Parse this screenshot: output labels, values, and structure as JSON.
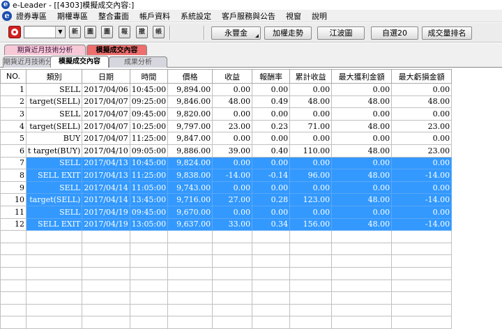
{
  "window": {
    "title": "e-Leader - [[4303]模擬成交內容:]"
  },
  "menu": [
    "證券專區",
    "期權專區",
    "整合畫面",
    "帳戶資料",
    "系統設定",
    "客戶服務與公告",
    "視窗",
    "說明"
  ],
  "toolbar": {
    "icons": [
      "新",
      "圖",
      "圖",
      "報",
      "撤",
      "帳"
    ],
    "buttons": [
      "永豐金",
      "加權走勢",
      "江波圖",
      "自選20",
      "成交量排名"
    ]
  },
  "tabs_row1": [
    "期貨近月技術分析",
    "模擬成交內容"
  ],
  "tabs_row2": [
    "期貨近月技術分析",
    "模擬成交內容",
    "成果分析"
  ],
  "table": {
    "headers": [
      "NO.",
      "類別",
      "日期",
      "時間",
      "價格",
      "收益",
      "報酬率",
      "累計收益",
      "最大獲利金額",
      "最大虧損金額"
    ],
    "rows": [
      {
        "no": "1",
        "type": "SELL",
        "date": "2017/04/06",
        "time": "10:45:00",
        "price": "9,894.00",
        "profit": "0.00",
        "ret": "0.00",
        "cum": "0.00",
        "maxp": "0.00",
        "maxl": "0.00",
        "selected": false
      },
      {
        "no": "2",
        "type": "target(SELL)",
        "date": "2017/04/07",
        "time": "09:25:00",
        "price": "9,846.00",
        "profit": "48.00",
        "ret": "0.49",
        "cum": "48.00",
        "maxp": "48.00",
        "maxl": "48.00",
        "selected": false
      },
      {
        "no": "3",
        "type": "SELL",
        "date": "2017/04/07",
        "time": "09:45:00",
        "price": "9,820.00",
        "profit": "0.00",
        "ret": "0.00",
        "cum": "0.00",
        "maxp": "0.00",
        "maxl": "0.00",
        "selected": false
      },
      {
        "no": "4",
        "type": "target(SELL)",
        "date": "2017/04/07",
        "time": "10:25:00",
        "price": "9,797.00",
        "profit": "23.00",
        "ret": "0.23",
        "cum": "71.00",
        "maxp": "48.00",
        "maxl": "23.00",
        "selected": false
      },
      {
        "no": "5",
        "type": "BUY",
        "date": "2017/04/07",
        "time": "11:25:00",
        "price": "9,847.00",
        "profit": "0.00",
        "ret": "0.00",
        "cum": "0.00",
        "maxp": "0.00",
        "maxl": "0.00",
        "selected": false
      },
      {
        "no": "6",
        "type": "t target(BUY)",
        "date": "2017/04/10",
        "time": "09:05:00",
        "price": "9,886.00",
        "profit": "39.00",
        "ret": "0.40",
        "cum": "110.00",
        "maxp": "48.00",
        "maxl": "23.00",
        "selected": false
      },
      {
        "no": "7",
        "type": "SELL",
        "date": "2017/04/13",
        "time": "10:45:00",
        "price": "9,824.00",
        "profit": "0.00",
        "ret": "0.00",
        "cum": "0.00",
        "maxp": "0.00",
        "maxl": "0.00",
        "selected": true
      },
      {
        "no": "8",
        "type": "SELL EXIT",
        "date": "2017/04/13",
        "time": "11:25:00",
        "price": "9,838.00",
        "profit": "-14.00",
        "ret": "-0.14",
        "cum": "96.00",
        "maxp": "48.00",
        "maxl": "-14.00",
        "selected": true
      },
      {
        "no": "9",
        "type": "SELL",
        "date": "2017/04/14",
        "time": "11:05:00",
        "price": "9,743.00",
        "profit": "0.00",
        "ret": "0.00",
        "cum": "0.00",
        "maxp": "0.00",
        "maxl": "0.00",
        "selected": true
      },
      {
        "no": "10",
        "type": "target(SELL)",
        "date": "2017/04/14",
        "time": "13:45:00",
        "price": "9,716.00",
        "profit": "27.00",
        "ret": "0.28",
        "cum": "123.00",
        "maxp": "48.00",
        "maxl": "-14.00",
        "selected": true
      },
      {
        "no": "11",
        "type": "SELL",
        "date": "2017/04/19",
        "time": "09:45:00",
        "price": "9,670.00",
        "profit": "0.00",
        "ret": "0.00",
        "cum": "0.00",
        "maxp": "0.00",
        "maxl": "0.00",
        "selected": true
      },
      {
        "no": "12",
        "type": "SELL EXIT",
        "date": "2017/04/19",
        "time": "13:05:00",
        "price": "9,637.00",
        "profit": "33.00",
        "ret": "0.34",
        "cum": "156.00",
        "maxp": "48.00",
        "maxl": "-14.00",
        "selected": true
      }
    ],
    "empty_rows": 8
  }
}
